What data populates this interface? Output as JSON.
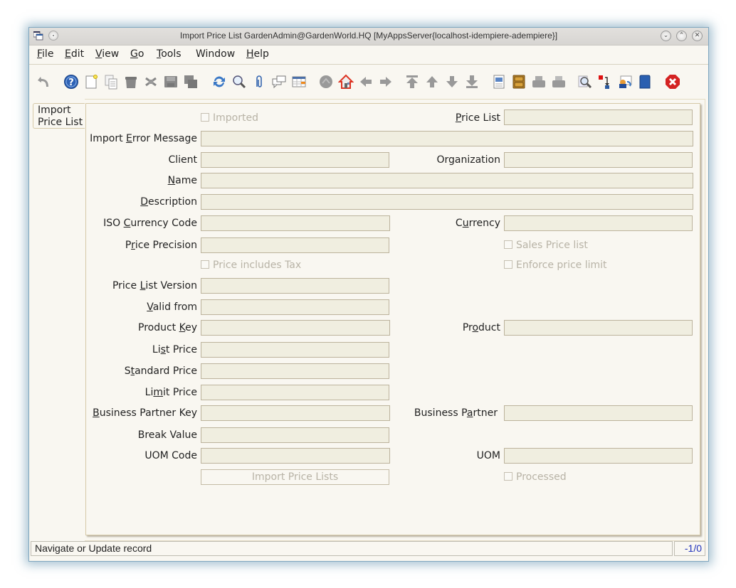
{
  "window": {
    "title": "Import Price List  GardenAdmin@GardenWorld.HQ [MyAppsServer{localhost-idempiere-adempiere}]",
    "buttons": [
      "minimize",
      "maximize",
      "close"
    ]
  },
  "menu": [
    {
      "label": "File",
      "mnemonic": "F",
      "rest": "ile"
    },
    {
      "label": "Edit",
      "mnemonic": "E",
      "rest": "dit"
    },
    {
      "label": "View",
      "mnemonic": "V",
      "rest": "iew"
    },
    {
      "label": "Go",
      "mnemonic": "G",
      "rest": "o"
    },
    {
      "label": "Tools",
      "mnemonic": "T",
      "rest": "ools"
    },
    {
      "label": "Window",
      "mnemonic": "",
      "rest": "Window"
    },
    {
      "label": "Help",
      "mnemonic": "H",
      "rest": "elp"
    }
  ],
  "toolbar": [
    "undo-icon",
    "help-icon",
    "new-record-icon",
    "copy-record-icon",
    "delete-icon",
    "delete-selection-icon",
    "save-icon",
    "save-and-new-icon",
    "refresh-icon",
    "find-icon",
    "attachment-icon",
    "chat-icon",
    "grid-toggle-icon",
    "history-icon",
    "home-icon",
    "parent-record-icon",
    "detail-record-icon",
    "first-record-icon",
    "previous-record-icon",
    "next-record-icon",
    "last-record-icon",
    "report-icon",
    "archive-icon",
    "print-preview-icon",
    "print-icon",
    "zoom-across-icon",
    "active-workflows-icon",
    "request-icon",
    "product-info-icon",
    "close-window-icon"
  ],
  "tab": {
    "label_line1": "Import",
    "label_line2": "Price List"
  },
  "form": {
    "imported": "Imported",
    "price_list": {
      "pre": "",
      "u": "P",
      "post": "rice List"
    },
    "import_error_message": {
      "pre": "Import ",
      "u": "E",
      "post": "rror Message"
    },
    "client": {
      "pre": "Client",
      "u": "",
      "post": ""
    },
    "organization": {
      "pre": "Organization",
      "u": "",
      "post": ""
    },
    "name": {
      "pre": "",
      "u": "N",
      "post": "ame"
    },
    "description": {
      "pre": "",
      "u": "D",
      "post": "escription"
    },
    "iso_currency_code": {
      "pre": "ISO ",
      "u": "C",
      "post": "urrency Code"
    },
    "currency": {
      "pre": "C",
      "u": "u",
      "post": "rrency"
    },
    "price_precision": {
      "pre": "P",
      "u": "r",
      "post": "ice Precision"
    },
    "sales_price_list": "Sales Price list",
    "price_includes_tax": "Price includes Tax",
    "enforce_price_limit": "Enforce price limit",
    "price_list_version": {
      "pre": "Price ",
      "u": "L",
      "post": "ist Version"
    },
    "valid_from": {
      "pre": "",
      "u": "V",
      "post": "alid from"
    },
    "product_key": {
      "pre": "Product ",
      "u": "K",
      "post": "ey"
    },
    "product": {
      "pre": "Pr",
      "u": "o",
      "post": "duct"
    },
    "list_price": {
      "pre": "Li",
      "u": "s",
      "post": "t Price"
    },
    "standard_price": {
      "pre": "S",
      "u": "t",
      "post": "andard Price"
    },
    "limit_price": {
      "pre": "Li",
      "u": "m",
      "post": "it Price"
    },
    "business_partner_key": {
      "pre": "",
      "u": "B",
      "post": "usiness Partner Key"
    },
    "business_partner": {
      "pre": "Business P",
      "u": "a",
      "post": "rtner"
    },
    "break_value": {
      "pre": "Break Value",
      "u": "",
      "post": ""
    },
    "uom_code": {
      "pre": "UOM Code",
      "u": "",
      "post": ""
    },
    "uom": {
      "pre": "UOM",
      "u": "",
      "post": ""
    },
    "import_button": "Import Price Lists",
    "processed": "Processed",
    "values": {
      "price_list": "",
      "import_error_message": "",
      "client": "",
      "organization": "",
      "name": "",
      "description": "",
      "iso_currency_code": "",
      "currency": "",
      "price_precision": "",
      "price_list_version": "",
      "valid_from": "",
      "product_key": "",
      "product": "",
      "list_price": "",
      "standard_price": "",
      "limit_price": "",
      "business_partner_key": "",
      "business_partner": "",
      "break_value": "",
      "uom_code": "",
      "uom": ""
    },
    "checkboxes": {
      "imported": false,
      "sales_price_list": false,
      "price_includes_tax": false,
      "enforce_price_limit": false,
      "processed": false
    }
  },
  "status": {
    "message": "Navigate or Update record",
    "record": "-1/0"
  }
}
